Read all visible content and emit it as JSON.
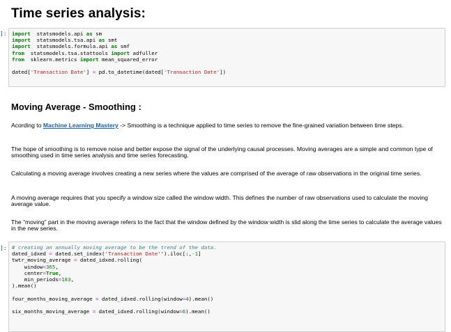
{
  "heading": "Time series analysis:",
  "cell1": {
    "prompt": "]:",
    "lines": [
      [
        [
          "kw",
          "import"
        ],
        [
          "",
          "  statsmodels.api "
        ],
        [
          "kw",
          "as"
        ],
        [
          "",
          " sm"
        ]
      ],
      [
        [
          "kw",
          "import"
        ],
        [
          "",
          "  statsmodels.tsa.api "
        ],
        [
          "kw",
          "as"
        ],
        [
          "",
          " smt"
        ]
      ],
      [
        [
          "kw",
          "import"
        ],
        [
          "",
          "  statsmodels.formula.api "
        ],
        [
          "kw",
          "as"
        ],
        [
          "",
          " smf"
        ]
      ],
      [
        [
          "kw",
          "from"
        ],
        [
          "",
          "  statsmodels.tsa.stattools "
        ],
        [
          "kw",
          "import"
        ],
        [
          "",
          " adfuller"
        ]
      ],
      [
        [
          "kw",
          "from"
        ],
        [
          "",
          "  sklearn.metrics "
        ],
        [
          "kw",
          "import"
        ],
        [
          "",
          " mean_squared_error"
        ]
      ],
      [],
      [
        [
          "",
          "dated["
        ],
        [
          "str",
          "'Transaction Date'"
        ],
        [
          "",
          "] "
        ],
        [
          "op",
          "="
        ],
        [
          "",
          " pd.to_datetime(dated["
        ],
        [
          "str",
          "'Transaction Date'"
        ],
        [
          "",
          "])"
        ]
      ]
    ]
  },
  "subheading": "Moving Average - Smoothing :",
  "p1": {
    "prefix": "Acording to ",
    "link": "Machine Learning Mastery",
    "suffix": " -> Smoothing is a technique applied to time series to remove the fine-grained variation between time steps."
  },
  "p2": "The hope of smoothing is to remove noise and better expose the signal of the underlying causal processes. Moving averages are a simple and common type of smoothing used in time series analysis and time series forecasting.",
  "p3": "Calculating a moving average involves creating a new series where the values are comprised of the average of raw observations in the original time series.",
  "p4": "A moving average requires that you specify a window size called the window width. This defines the number of raw observations used to calculate the moving average value.",
  "p5": "The “moving” part in the moving average refers to the fact that the window defined by the window width is slid along the time series to calculate the average values in the new series.",
  "cell2": {
    "prompt": "]:",
    "lines": [
      [
        [
          "cmt",
          "# creating an annually moving average to be the trend of the data."
        ]
      ],
      [
        [
          "",
          "dated_idxed "
        ],
        [
          "op",
          "="
        ],
        [
          "",
          " dated.set_index("
        ],
        [
          "str",
          "'Transaction Date'"
        ],
        [
          "",
          "').iloc[:,"
        ],
        [
          "op",
          "-"
        ],
        [
          "num",
          "1"
        ],
        [
          "",
          "]"
        ]
      ],
      [
        [
          "",
          "twtr_moving_average "
        ],
        [
          "op",
          "="
        ],
        [
          "",
          " dated_idxed.rolling("
        ]
      ],
      [
        [
          "",
          "    window"
        ],
        [
          "op",
          "="
        ],
        [
          "num",
          "365"
        ],
        [
          "",
          ","
        ]
      ],
      [
        [
          "",
          "    center"
        ],
        [
          "op",
          "="
        ],
        [
          "kw",
          "True"
        ],
        [
          "",
          ","
        ]
      ],
      [
        [
          "",
          "    min_periods"
        ],
        [
          "op",
          "="
        ],
        [
          "num",
          "183"
        ],
        [
          "",
          ","
        ]
      ],
      [
        [
          "",
          ").mean()"
        ]
      ],
      [],
      [
        [
          "",
          "four_months_moving_average "
        ],
        [
          "op",
          "="
        ],
        [
          "",
          " dated_idxed.rolling(window"
        ],
        [
          "op",
          "="
        ],
        [
          "num",
          "4"
        ],
        [
          "",
          ").mean()"
        ]
      ],
      [],
      [
        [
          "",
          "six_months_moving_average "
        ],
        [
          "op",
          "="
        ],
        [
          "",
          " dated_idxed.rolling(window"
        ],
        [
          "op",
          "="
        ],
        [
          "num",
          "6"
        ],
        [
          "",
          ").mean()"
        ]
      ]
    ]
  }
}
